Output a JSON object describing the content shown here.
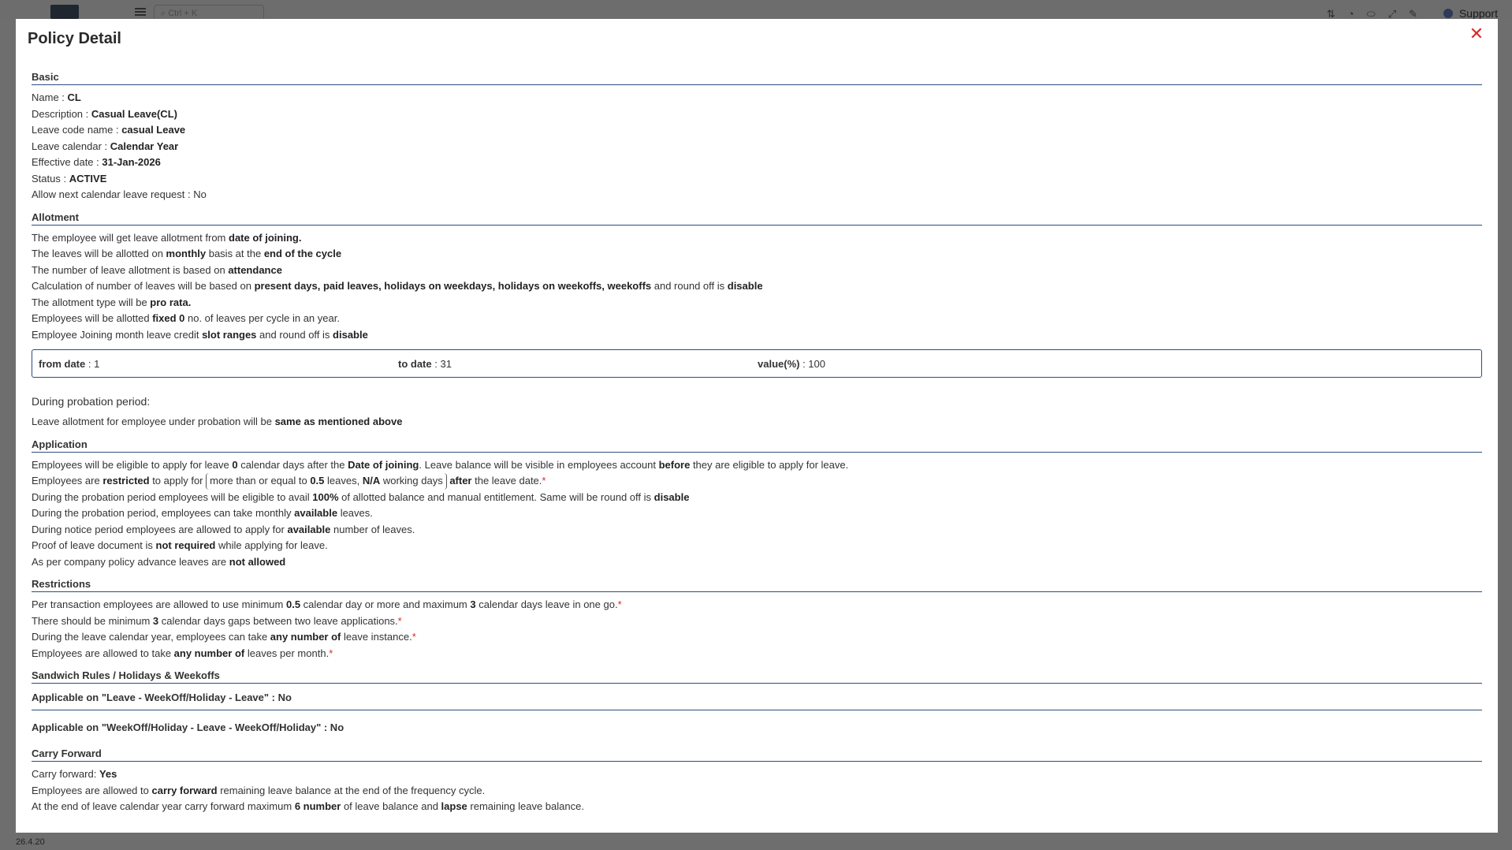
{
  "background": {
    "search_placeholder": "Ctrl + K",
    "support_label": "Support",
    "version": "26.4.20"
  },
  "modal": {
    "title": "Policy Detail"
  },
  "basic": {
    "title": "Basic",
    "name_label": "Name : ",
    "name_value": "CL",
    "description_label": "Description : ",
    "description_value": "Casual Leave(CL)",
    "leave_code_label": "Leave code name : ",
    "leave_code_value": "casual Leave",
    "calendar_label": "Leave calendar : ",
    "calendar_value": "Calendar Year",
    "effective_label": "Effective date : ",
    "effective_value": "31-Jan-2026",
    "status_label": "Status : ",
    "status_value": "ACTIVE",
    "next_request_label": "Allow next calendar leave request : ",
    "next_request_value": "No"
  },
  "allotment": {
    "title": "Allotment",
    "l1_a": "The employee will get leave allotment from ",
    "l1_b": "date of joining.",
    "l2_a": "The leaves will be allotted on ",
    "l2_b": "monthly",
    "l2_c": " basis at the ",
    "l2_d": "end of the cycle",
    "l3_a": "The number of leave allotment is based on ",
    "l3_b": "attendance",
    "l4_a": "Calculation of number of leaves will be based on ",
    "l4_b": "present days, paid leaves, holidays on weekdays, holidays on weekoffs, weekoffs",
    "l4_c": " and round off is ",
    "l4_d": "disable",
    "l5_a": "The allotment type will be ",
    "l5_b": "pro rata.",
    "l6_a": "Employees will be allotted ",
    "l6_b": "fixed 0",
    "l6_c": " no. of leaves per cycle in an year.",
    "l7_a": "Employee Joining month leave credit ",
    "l7_b": "slot ranges",
    "l7_c": " and round off is ",
    "l7_d": "disable",
    "slot": {
      "from_label": "from date",
      "from_value": " : 1",
      "to_label": "to date",
      "to_value": " : 31",
      "value_label": "value(%)",
      "value_value": " : 100"
    },
    "probation_heading": "During probation period:",
    "probation_a": "Leave allotment for employee under probation will be ",
    "probation_b": "same as mentioned above"
  },
  "application": {
    "title": "Application",
    "l1_a": "Employees will be eligible to apply for leave ",
    "l1_b": "0",
    "l1_c": " calendar days after the ",
    "l1_d": "Date of joining",
    "l1_e": ". Leave balance will be visible in employees account ",
    "l1_f": "before",
    "l1_g": " they are eligible to apply for leave.",
    "l2_a": "Employees are ",
    "l2_b": "restricted",
    "l2_c": " to apply for ",
    "l2_d": "more than or equal to ",
    "l2_e": "0.5",
    "l2_f": " leaves, ",
    "l2_g": "N/A",
    "l2_h": " working days",
    "l2_i": " after",
    "l2_j": " the leave date.",
    "l3_a": "During the probation period employees will be eligible to avail ",
    "l3_b": "100%",
    "l3_c": " of allotted balance and manual entitlement. Same will be round off is ",
    "l3_d": "disable",
    "l4_a": "During the probation period, employees can take monthly ",
    "l4_b": "available",
    "l4_c": " leaves.",
    "l5_a": "During notice period employees are allowed to apply for ",
    "l5_b": "available",
    "l5_c": " number of leaves.",
    "l6_a": "Proof of leave document is ",
    "l6_b": "not required",
    "l6_c": " while applying for leave.",
    "l7_a": "As per company policy advance leaves are ",
    "l7_b": "not allowed"
  },
  "restrictions": {
    "title": "Restrictions",
    "l1_a": "Per transaction employees are allowed to use minimum ",
    "l1_b": "0.5",
    "l1_c": " calendar day or more and maximum ",
    "l1_d": "3",
    "l1_e": " calendar days leave in one go.",
    "l2_a": "There should be minimum ",
    "l2_b": "3",
    "l2_c": " calendar days gaps between two leave applications.",
    "l3_a": "During the leave calendar year, employees can take ",
    "l3_b": "any number of",
    "l3_c": " leave instance.",
    "l4_a": "Employees are allowed to take ",
    "l4_b": "any number of",
    "l4_c": " leaves per month.",
    "asterisk": "*"
  },
  "sandwich": {
    "title": "Sandwich Rules / Holidays & Weekoffs",
    "r1": "Applicable on \"Leave - WeekOff/Holiday - Leave\" : No",
    "r2": "Applicable on \"WeekOff/Holiday - Leave - WeekOff/Holiday\" : No"
  },
  "carry_forward": {
    "title": "Carry Forward",
    "l1_a": "Carry forward: ",
    "l1_b": "Yes",
    "l2_a": "Employees are allowed to ",
    "l2_b": "carry forward",
    "l2_c": " remaining leave balance at the end of the frequency cycle.",
    "l3_a": "At the end of leave calendar year carry forward maximum ",
    "l3_b": "6 number",
    "l3_c": " of leave balance and ",
    "l3_d": "lapse",
    "l3_e": " remaining leave balance."
  }
}
